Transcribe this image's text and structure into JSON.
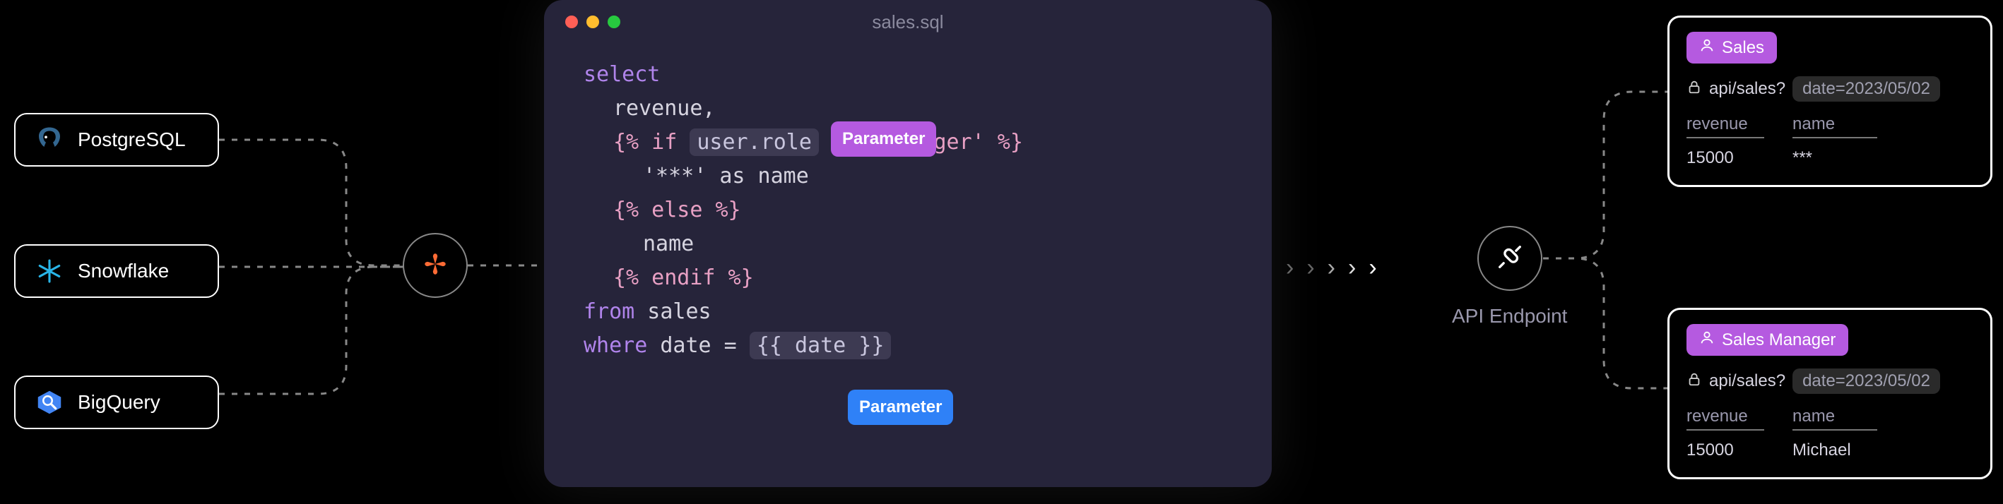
{
  "sources": [
    {
      "name": "PostgreSQL",
      "icon": "postgres"
    },
    {
      "name": "Snowflake",
      "icon": "snowflake"
    },
    {
      "name": "BigQuery",
      "icon": "bigquery"
    }
  ],
  "editor": {
    "filename": "sales.sql",
    "code": {
      "l1_kw": "select",
      "l2_fld": "revenue,",
      "l3_tmpl_open": "{% if ",
      "l3_chip": "user.role",
      "l3_tmpl_rest": " != 'manager' %}",
      "l4": "'***' as name",
      "l5": "{% else %}",
      "l6": "name",
      "l7": "{% endif %}",
      "l8_kw": "from",
      "l8_fld": " sales",
      "l9_kw": "where",
      "l9_fld": " date = ",
      "l9_chip": "{{ date }}"
    },
    "param_badge1": "Parameter",
    "param_badge2": "Parameter"
  },
  "api_node_label": "API Endpoint",
  "results": [
    {
      "role": "Sales",
      "path": "api/sales?",
      "query": "date=2023/05/02",
      "headers": {
        "rev": "revenue",
        "name": "name"
      },
      "row": {
        "rev": "15000",
        "name": "***"
      }
    },
    {
      "role": "Sales Manager",
      "path": "api/sales?",
      "query": "date=2023/05/02",
      "headers": {
        "rev": "revenue",
        "name": "name"
      },
      "row": {
        "rev": "15000",
        "name": "Michael"
      }
    }
  ]
}
